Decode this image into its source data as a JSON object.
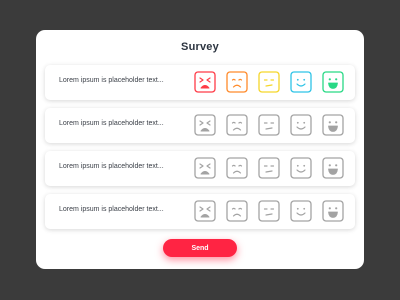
{
  "survey": {
    "title": "Survey",
    "send_label": "Send",
    "questions": [
      {
        "text": "Lorem ipsum is placeholder text...",
        "colored": true
      },
      {
        "text": "Lorem ipsum is placeholder text...",
        "colored": false
      },
      {
        "text": "Lorem ipsum is placeholder text...",
        "colored": false
      },
      {
        "text": "Lorem ipsum is placeholder text...",
        "colored": false
      }
    ],
    "faces": [
      {
        "icon": "very-sad-face-icon",
        "active_color": "#ff3b47"
      },
      {
        "icon": "sad-face-icon",
        "active_color": "#ff8a2a"
      },
      {
        "icon": "neutral-face-icon",
        "active_color": "#f5d62a"
      },
      {
        "icon": "happy-face-icon",
        "active_color": "#2ec3e6"
      },
      {
        "icon": "very-happy-face-icon",
        "active_color": "#28d985"
      }
    ],
    "inactive_color": "#a3a3a3",
    "accent": "#ff2443"
  }
}
